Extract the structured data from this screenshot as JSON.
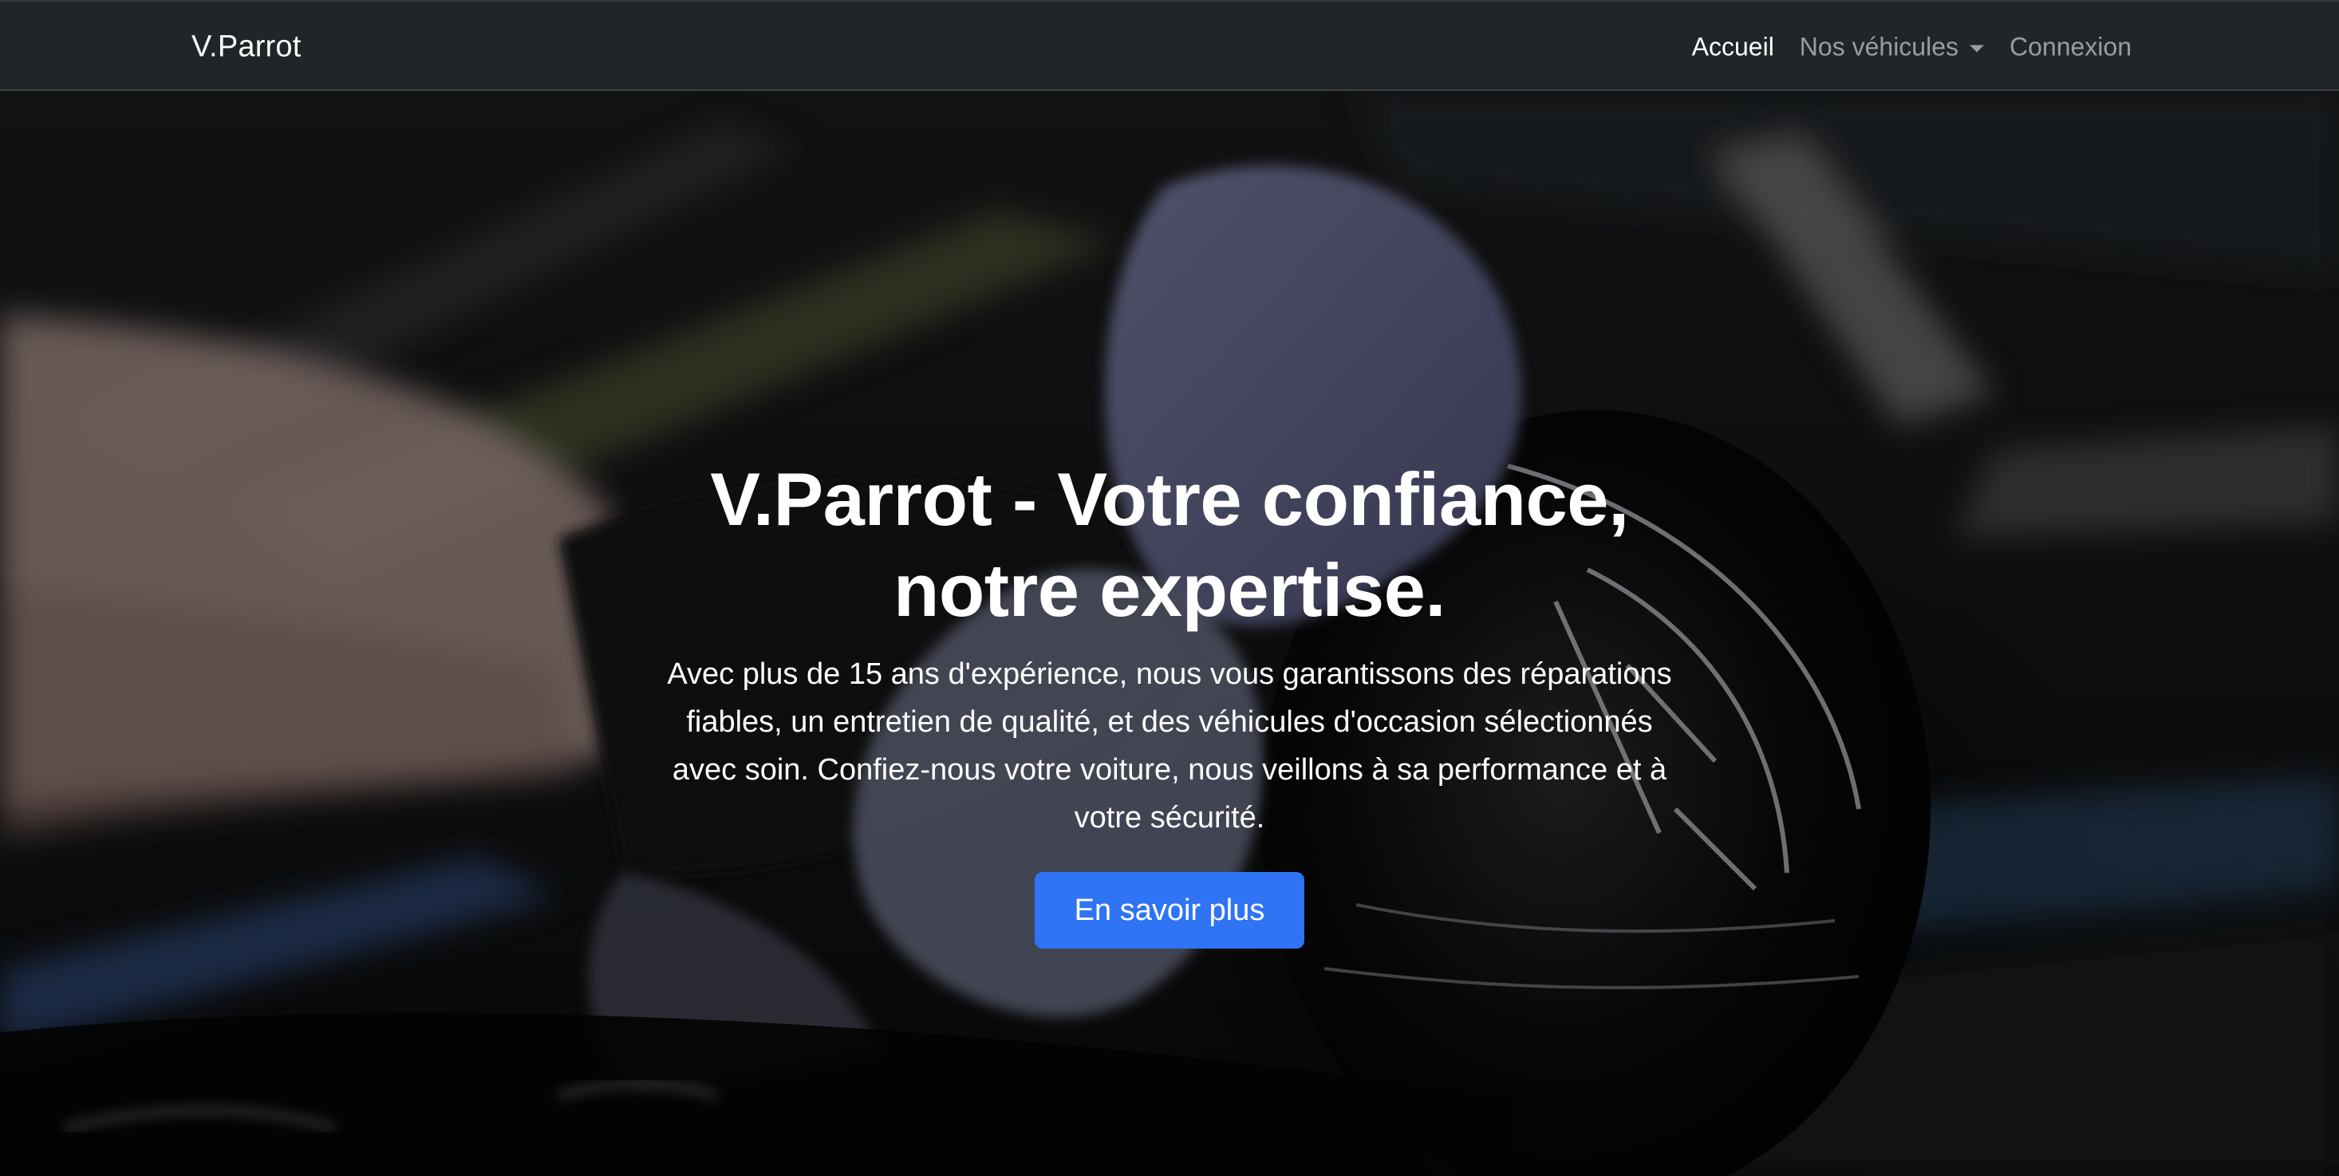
{
  "navbar": {
    "brand": "V.Parrot",
    "links": [
      {
        "label": "Accueil",
        "active": true
      },
      {
        "label": "Nos véhicules",
        "dropdown": true
      },
      {
        "label": "Connexion"
      }
    ]
  },
  "hero": {
    "title": "V.Parrot - Votre confiance, notre expertise.",
    "description": "Avec plus de 15 ans d'expérience, nous vous garantissons des réparations fiables, un entretien de qualité, et des véhicules d'occasion sélectionnés avec soin. Confiez-nous votre voiture, nous veillons à sa performance et à votre sécurité.",
    "cta_label": "En savoir plus"
  },
  "colors": {
    "navbar_bg": "#212529",
    "cta_bg": "#2f74f5",
    "text": "#ffffff",
    "muted_nav": "rgba(255,255,255,0.55)"
  },
  "icons": {
    "dropdown": "chevron-down-icon"
  }
}
